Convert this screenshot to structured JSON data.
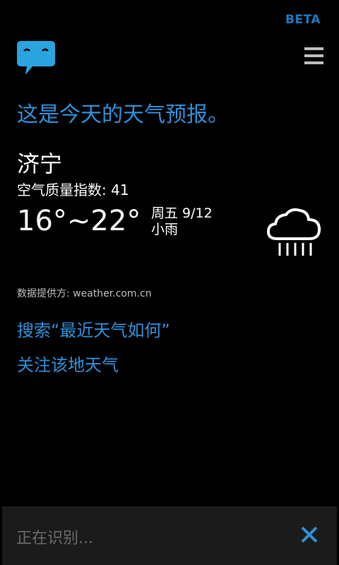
{
  "header": {
    "beta_label": "BETA"
  },
  "headline": "这是今天的天气预报。",
  "weather": {
    "city": "济宁",
    "aqi_text": "空气质量指数: 41",
    "temp_range": "16°~22°",
    "day_date": "周五 9/12",
    "condition": "小雨",
    "icon": "rain-cloud-icon"
  },
  "source_text": "数据提供方: weather.com.cn",
  "links": {
    "search_recent": "搜索“最近天气如何”",
    "follow_weather": "关注该地天气"
  },
  "bottom_bar": {
    "status": "正在识别..."
  },
  "colors": {
    "accent": "#2e8fd8",
    "background": "#000000",
    "bar": "#1b1b1b"
  }
}
